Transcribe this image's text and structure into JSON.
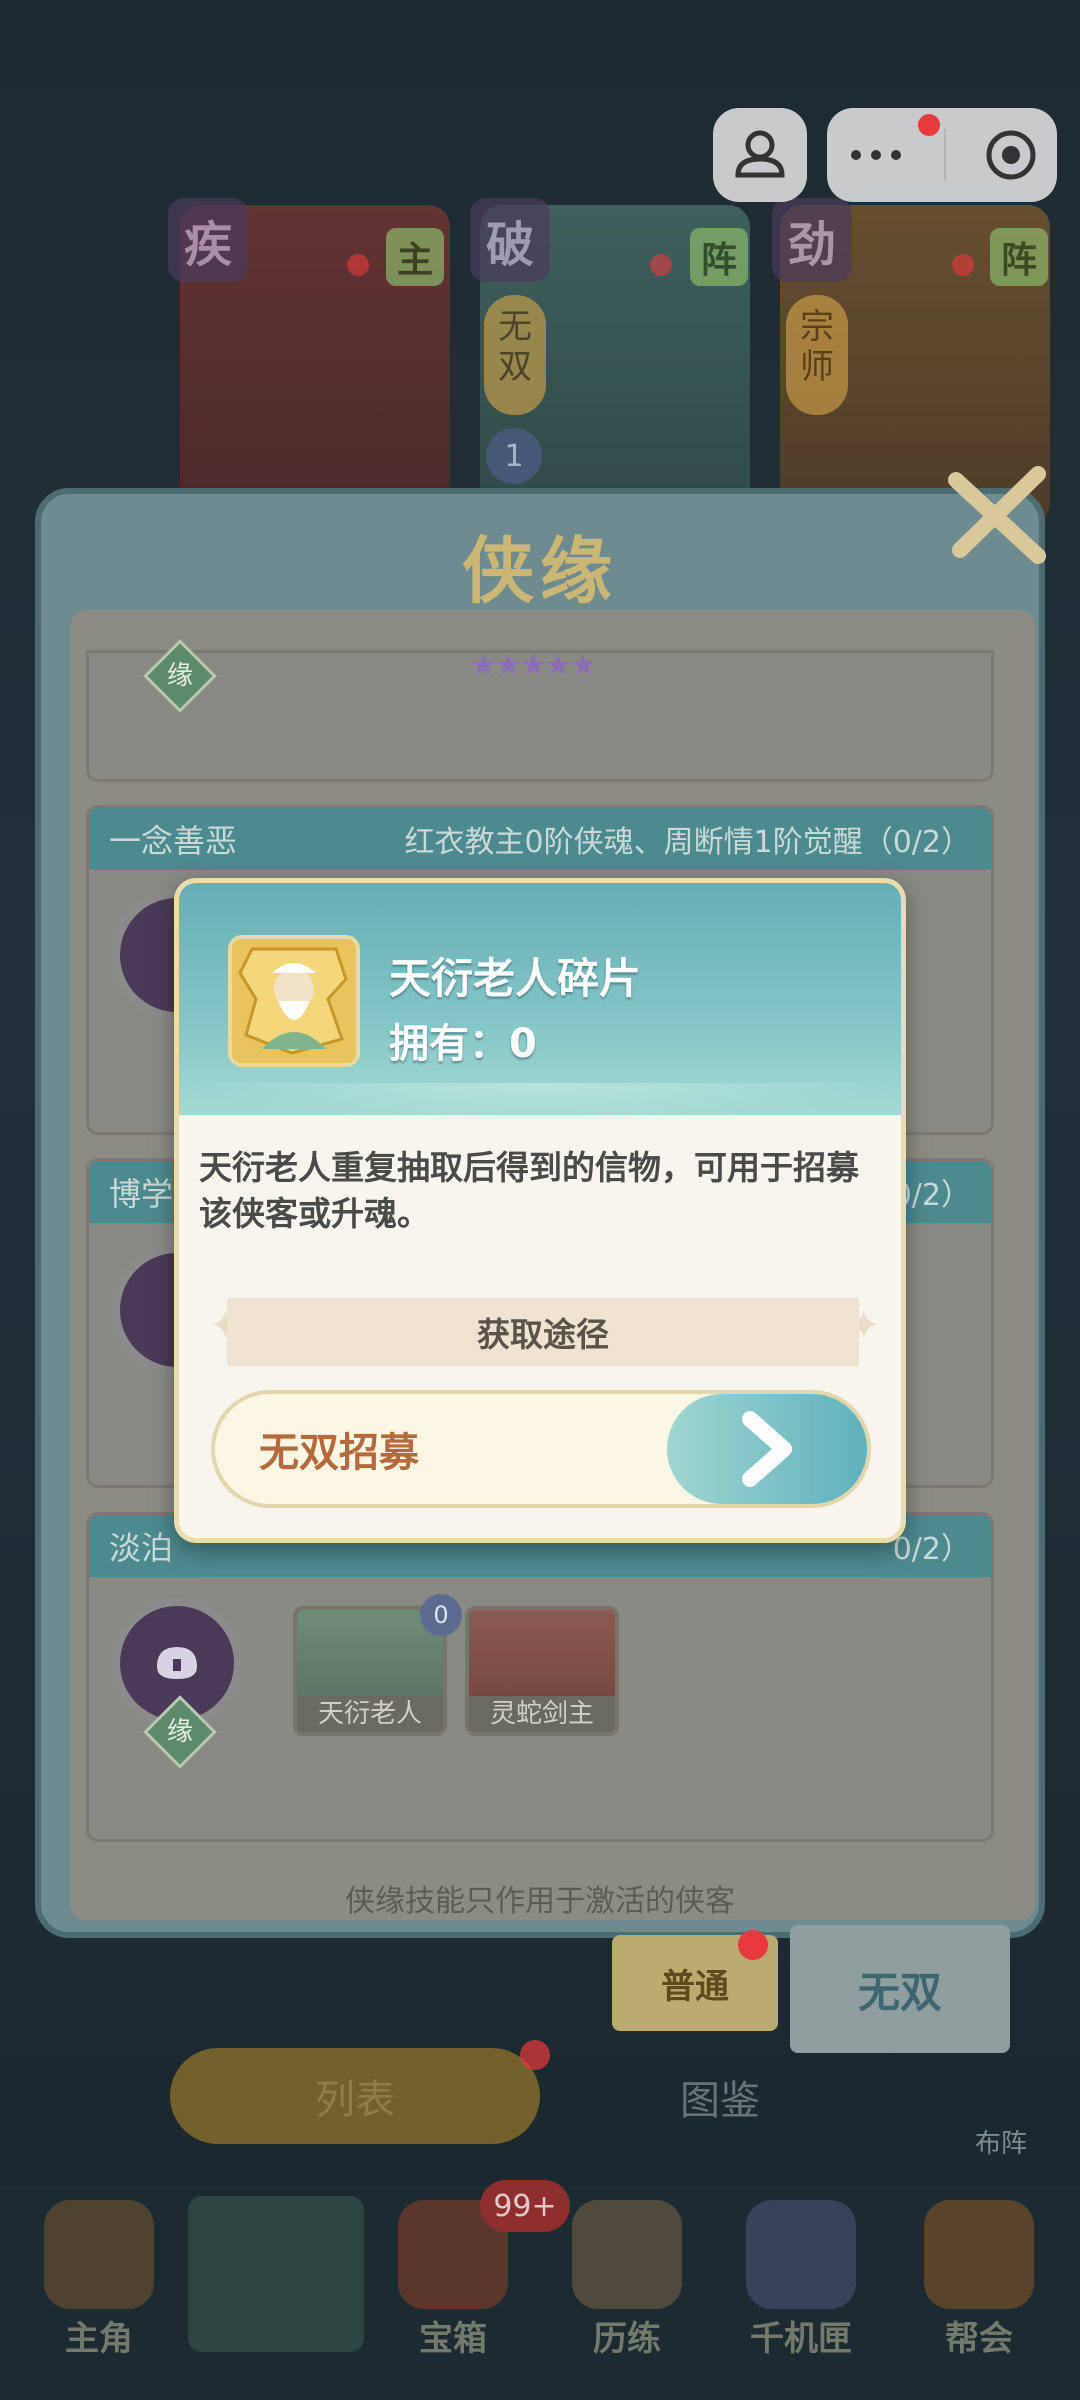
{
  "top_cards": [
    {
      "badge": "疾",
      "tag": "主"
    },
    {
      "badge": "破",
      "tag": "阵",
      "vertical": "无双",
      "num": "1"
    },
    {
      "badge": "劲",
      "tag": "阵",
      "vertical": "宗师"
    }
  ],
  "panel": {
    "title": "侠缘",
    "footer_note": "侠缘技能只作用于激活的侠客",
    "yuan_label": "缘",
    "blocks": [
      {
        "name": "一念善恶",
        "requirement": "红衣教主0阶侠魂、周断情1阶觉醒（0/2）"
      },
      {
        "name": "博学",
        "requirement": "0/2）"
      },
      {
        "name": "淡泊",
        "requirement": "0/2）"
      }
    ],
    "heroes": [
      {
        "name": "天衍老人",
        "count": "0"
      },
      {
        "name": "灵蛇剑主"
      }
    ],
    "tabs": {
      "normal": "普通",
      "wushuang": "无双"
    }
  },
  "popup": {
    "item_name": "天衍老人碎片",
    "owned_label": "拥有：",
    "owned_value": "0",
    "description": "天衍老人重复抽取后得到的信物，可用于招募该侠客或升魂。",
    "source_title": "获取途径",
    "source_button": "无双招募"
  },
  "bottom": {
    "list": "列表",
    "tujian": "图鉴",
    "buzhen": "布阵",
    "badge": "99+",
    "nav": [
      "主角",
      "宝箱",
      "历练",
      "千机匣",
      "帮会"
    ]
  }
}
